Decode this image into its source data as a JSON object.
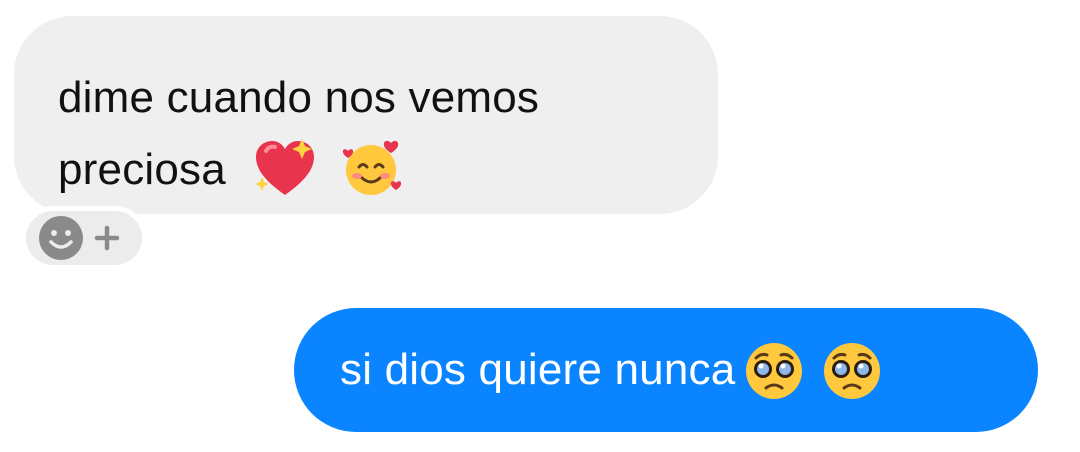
{
  "incoming_message": {
    "line1": "dime cuando nos vemos",
    "line2": "preciosa",
    "emojis": [
      "sparkling-heart-icon",
      "smiling-face-with-hearts-icon"
    ]
  },
  "reaction_button": {
    "icons": [
      "smiley-icon",
      "plus-icon"
    ]
  },
  "outgoing_message": {
    "text": "si dios quiere nunca",
    "emojis": [
      "pleading-face-icon",
      "pleading-face-icon"
    ]
  },
  "colors": {
    "incoming_bubble": "#efefef",
    "outgoing_bubble": "#0a84ff",
    "reaction_bg": "#ececec",
    "reaction_icon": "#8a8a8a"
  }
}
